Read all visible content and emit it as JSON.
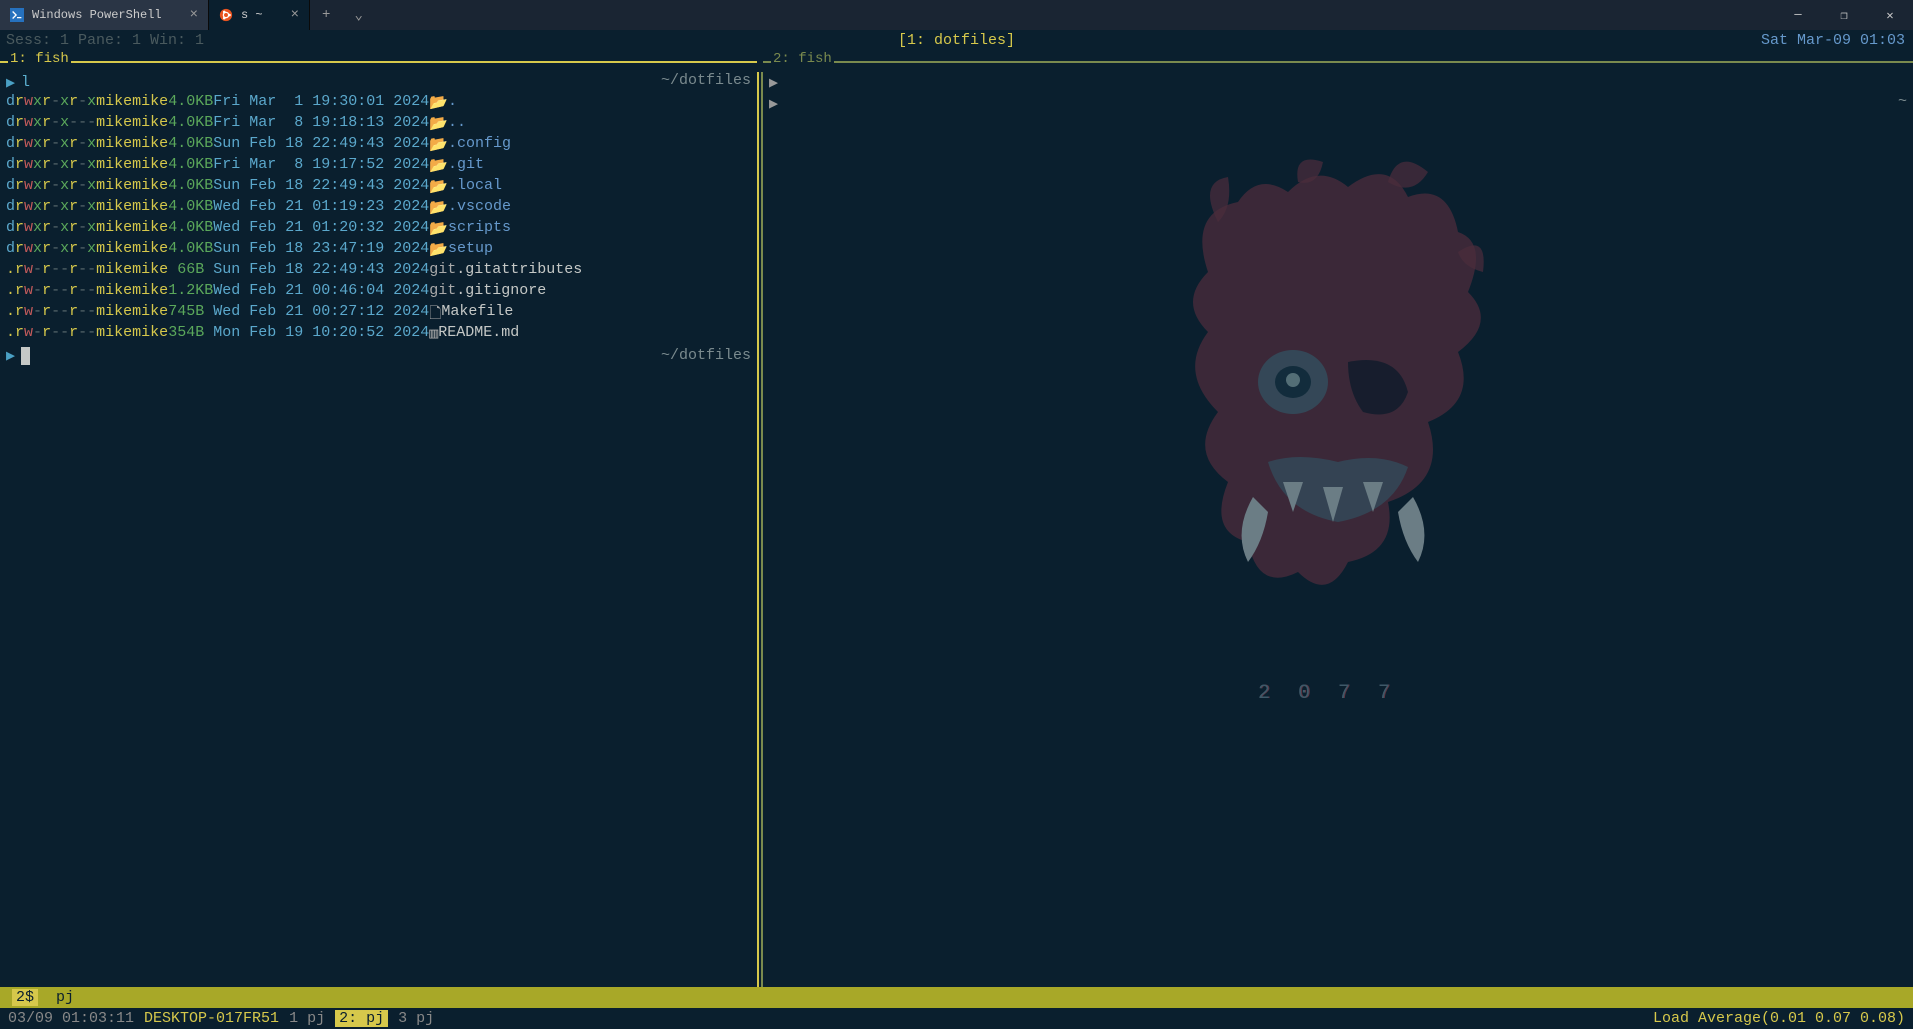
{
  "titlebar": {
    "tabs": [
      {
        "icon": "powershell-icon",
        "label": "Windows PowerShell"
      },
      {
        "icon": "ubuntu-icon",
        "label": "s ~"
      }
    ],
    "new_tab": "+",
    "dropdown": "⌄"
  },
  "tmux": {
    "session_info": "Sess: 1 Pane: 1 Win: 1",
    "window_title": "[1: dotfiles]",
    "clock": "Sat Mar-09 01:03",
    "pane1_label": "1: fish",
    "pane2_label": "2: fish"
  },
  "left_pane": {
    "path": "~/dotfiles",
    "prompt_cmd": "l",
    "listing": [
      {
        "perms": "drwxr-xr-x",
        "owner": "mike",
        "group": "mike",
        "size": "4.0",
        "unit": "KB",
        "date": "Fri Mar  1 19:30:01 2024",
        "icon": "folder",
        "name": "."
      },
      {
        "perms": "drwxr-x---",
        "owner": "mike",
        "group": "mike",
        "size": "4.0",
        "unit": "KB",
        "date": "Fri Mar  8 19:18:13 2024",
        "icon": "folder",
        "name": ".."
      },
      {
        "perms": "drwxr-xr-x",
        "owner": "mike",
        "group": "mike",
        "size": "4.0",
        "unit": "KB",
        "date": "Sun Feb 18 22:49:43 2024",
        "icon": "folder",
        "name": ".config"
      },
      {
        "perms": "drwxr-xr-x",
        "owner": "mike",
        "group": "mike",
        "size": "4.0",
        "unit": "KB",
        "date": "Fri Mar  8 19:17:52 2024",
        "icon": "folder",
        "name": ".git"
      },
      {
        "perms": "drwxr-xr-x",
        "owner": "mike",
        "group": "mike",
        "size": "4.0",
        "unit": "KB",
        "date": "Sun Feb 18 22:49:43 2024",
        "icon": "folder",
        "name": ".local"
      },
      {
        "perms": "drwxr-xr-x",
        "owner": "mike",
        "group": "mike",
        "size": "4.0",
        "unit": "KB",
        "date": "Wed Feb 21 01:19:23 2024",
        "icon": "folder",
        "name": ".vscode"
      },
      {
        "perms": "drwxr-xr-x",
        "owner": "mike",
        "group": "mike",
        "size": "4.0",
        "unit": "KB",
        "date": "Wed Feb 21 01:20:32 2024",
        "icon": "folder",
        "name": "scripts"
      },
      {
        "perms": "drwxr-xr-x",
        "owner": "mike",
        "group": "mike",
        "size": "4.0",
        "unit": "KB",
        "date": "Sun Feb 18 23:47:19 2024",
        "icon": "folder",
        "name": "setup"
      },
      {
        "perms": ".rw-r--r--",
        "owner": "mike",
        "group": "mike",
        "size": " 66",
        "unit": "B ",
        "date": "Sun Feb 18 22:49:43 2024",
        "icon": "git",
        "name": ".gitattributes"
      },
      {
        "perms": ".rw-r--r--",
        "owner": "mike",
        "group": "mike",
        "size": "1.2",
        "unit": "KB",
        "date": "Wed Feb 21 00:46:04 2024",
        "icon": "git",
        "name": ".gitignore"
      },
      {
        "perms": ".rw-r--r--",
        "owner": "mike",
        "group": "mike",
        "size": "745",
        "unit": "B ",
        "date": "Wed Feb 21 00:27:12 2024",
        "icon": "file",
        "name": "Makefile"
      },
      {
        "perms": ".rw-r--r--",
        "owner": "mike",
        "group": "mike",
        "size": "354",
        "unit": "B ",
        "date": "Mon Feb 19 10:20:52 2024",
        "icon": "md",
        "name": "README.md"
      }
    ]
  },
  "right_pane": {
    "bg_year": "2077",
    "tilde": "~"
  },
  "screen_bar": {
    "num": "2$",
    "cmd": "pj"
  },
  "status": {
    "time": "03/09 01:03:11",
    "host": "DESKTOP-017FR51",
    "windows": [
      {
        "label": "1 pj",
        "active": false
      },
      {
        "label": "2: pj",
        "active": true
      },
      {
        "label": "3 pj",
        "active": false
      }
    ],
    "load": "Load Average(0.01 0.07 0.08)"
  }
}
